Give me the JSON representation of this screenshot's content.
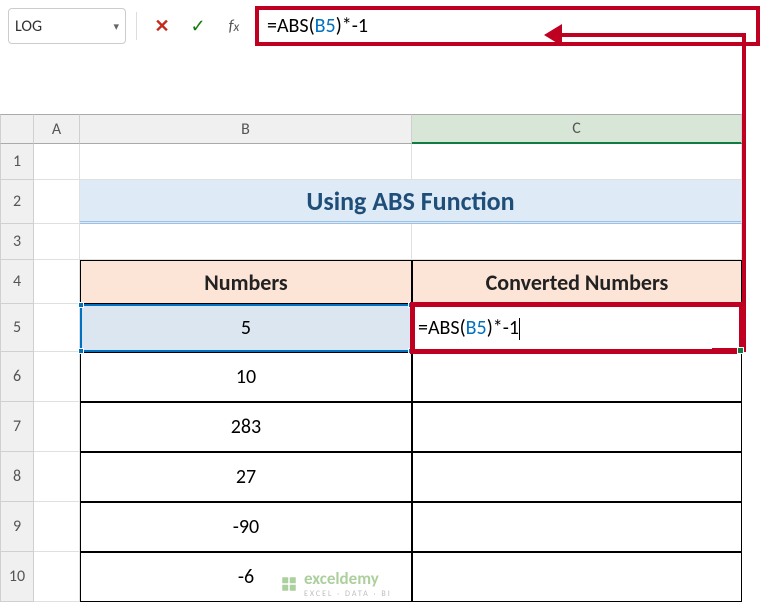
{
  "nameBox": "LOG",
  "formulaBar": {
    "prefix": "=ABS(",
    "ref": "B5",
    "suffix": ")*-1"
  },
  "columns": {
    "A": "A",
    "B": "B",
    "C": "C"
  },
  "rows": [
    "1",
    "2",
    "3",
    "4",
    "5",
    "6",
    "7",
    "8",
    "9",
    "10"
  ],
  "title": "Using ABS Function",
  "headers": {
    "numbers": "Numbers",
    "converted": "Converted Numbers"
  },
  "data": {
    "b5": "5",
    "b6": "10",
    "b7": "283",
    "b8": "27",
    "b9": "-90",
    "b10": "-6"
  },
  "editingCell": {
    "prefix": "=ABS(",
    "ref": "B5",
    "suffix": ")*-1"
  },
  "watermark": {
    "brand": "exceldemy",
    "sub": "EXCEL · DATA · BI"
  }
}
